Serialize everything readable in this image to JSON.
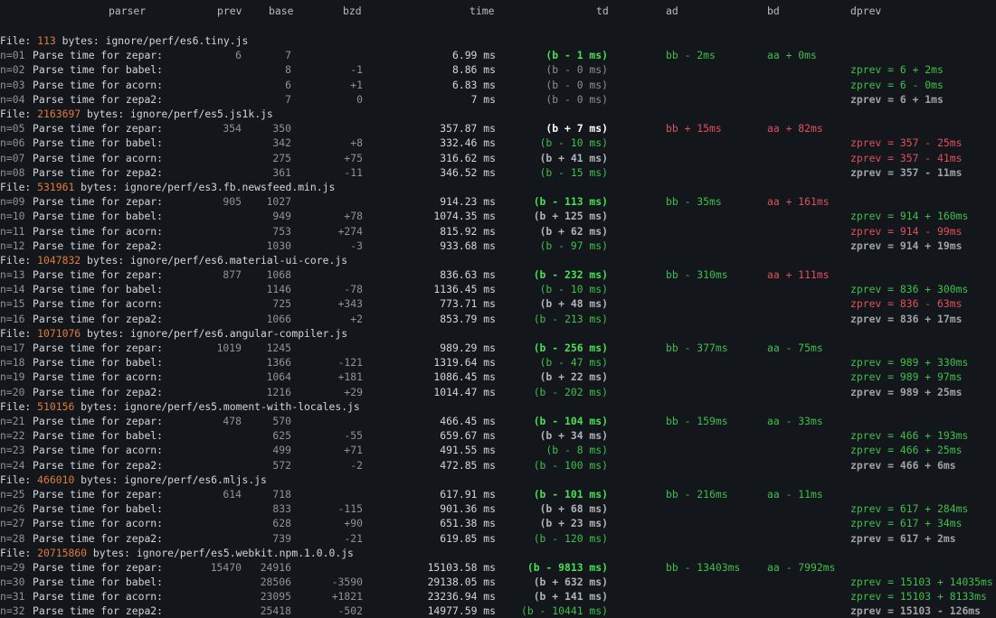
{
  "headers": {
    "parser": "parser",
    "prev": "prev",
    "base": "base",
    "bzd": "bzd",
    "time": "time",
    "td": "td",
    "ad": "ad",
    "bd": "bd",
    "dprev": "dprev"
  },
  "colors": {
    "background": "#13171c",
    "file_size": "#e07b3a",
    "green": "#3fbf4a",
    "red": "#e0505a",
    "white_bold": "#ffffff",
    "grey": "#8b9096"
  },
  "files": [
    {
      "prefix": "File: ",
      "size": "113",
      "path": " bytes: ignore/perf/es6.tiny.js",
      "rows": [
        {
          "n": "n=01",
          "label": "Parse time for zepar:",
          "prev": "6",
          "base": "7",
          "bzd": "",
          "time": "6.99 ms",
          "td": "(b - 1 ms)",
          "td_style": "bgreen",
          "ad": "bb - 2ms",
          "ad_style": "green",
          "bd": "aa + 0ms",
          "bd_style": "green",
          "dprev": "",
          "dprev_style": ""
        },
        {
          "n": "n=02",
          "label": "Parse time for babel:",
          "prev": "",
          "base": "8",
          "bzd": "-1",
          "time": "8.86 ms",
          "td": "(b - 0 ms)",
          "td_style": "grey",
          "ad": "",
          "ad_style": "",
          "bd": "",
          "bd_style": "",
          "dprev": "zprev = 6 + 2ms",
          "dprev_style": "pgreen"
        },
        {
          "n": "n=03",
          "label": "Parse time for acorn:",
          "prev": "",
          "base": "6",
          "bzd": "+1",
          "time": "6.83 ms",
          "td": "(b - 0 ms)",
          "td_style": "grey",
          "ad": "",
          "ad_style": "",
          "bd": "",
          "bd_style": "",
          "dprev": "zprev = 6 - 0ms",
          "dprev_style": "pgreen"
        },
        {
          "n": "n=04",
          "label": "Parse time for zepa2:",
          "prev": "",
          "base": "7",
          "bzd": "0",
          "time": "7 ms",
          "td": "(b - 0 ms)",
          "td_style": "grey",
          "ad": "",
          "ad_style": "",
          "bd": "",
          "bd_style": "",
          "dprev": "zprev = 6 + 1ms",
          "dprev_style": "pgrey"
        }
      ]
    },
    {
      "prefix": "File: ",
      "size": "2163697",
      "path": " bytes: ignore/perf/es5.js1k.js",
      "rows": [
        {
          "n": "n=05",
          "label": "Parse time for zepar:",
          "prev": "354",
          "base": "350",
          "bzd": "",
          "time": "357.87 ms",
          "td": "(b + 7 ms)",
          "td_style": "white",
          "ad": "bb + 15ms",
          "ad_style": "red",
          "bd": "aa + 82ms",
          "bd_style": "red",
          "dprev": "",
          "dprev_style": ""
        },
        {
          "n": "n=06",
          "label": "Parse time for babel:",
          "prev": "",
          "base": "342",
          "bzd": "+8",
          "time": "332.46 ms",
          "td": "(b - 10 ms)",
          "td_style": "green",
          "ad": "",
          "ad_style": "",
          "bd": "",
          "bd_style": "",
          "dprev": "zprev = 357 - 25ms",
          "dprev_style": "pred"
        },
        {
          "n": "n=07",
          "label": "Parse time for acorn:",
          "prev": "",
          "base": "275",
          "bzd": "+75",
          "time": "316.62 ms",
          "td": "(b + 41 ms)",
          "td_style": "bgrey",
          "ad": "",
          "ad_style": "",
          "bd": "",
          "bd_style": "",
          "dprev": "zprev = 357 - 41ms",
          "dprev_style": "pred"
        },
        {
          "n": "n=08",
          "label": "Parse time for zepa2:",
          "prev": "",
          "base": "361",
          "bzd": "-11",
          "time": "346.52 ms",
          "td": "(b - 15 ms)",
          "td_style": "green",
          "ad": "",
          "ad_style": "",
          "bd": "",
          "bd_style": "",
          "dprev": "zprev = 357 - 11ms",
          "dprev_style": "pgrey"
        }
      ]
    },
    {
      "prefix": "File: ",
      "size": "531961",
      "path": " bytes: ignore/perf/es3.fb.newsfeed.min.js",
      "rows": [
        {
          "n": "n=09",
          "label": "Parse time for zepar:",
          "prev": "905",
          "base": "1027",
          "bzd": "",
          "time": "914.23 ms",
          "td": "(b - 113 ms)",
          "td_style": "bgreen",
          "ad": "bb - 35ms",
          "ad_style": "green",
          "bd": "aa + 161ms",
          "bd_style": "red",
          "dprev": "",
          "dprev_style": ""
        },
        {
          "n": "n=10",
          "label": "Parse time for babel:",
          "prev": "",
          "base": "949",
          "bzd": "+78",
          "time": "1074.35 ms",
          "td": "(b + 125 ms)",
          "td_style": "bgrey",
          "ad": "",
          "ad_style": "",
          "bd": "",
          "bd_style": "",
          "dprev": "zprev = 914 + 160ms",
          "dprev_style": "pgreen"
        },
        {
          "n": "n=11",
          "label": "Parse time for acorn:",
          "prev": "",
          "base": "753",
          "bzd": "+274",
          "time": "815.92 ms",
          "td": "(b + 62 ms)",
          "td_style": "bgrey",
          "ad": "",
          "ad_style": "",
          "bd": "",
          "bd_style": "",
          "dprev": "zprev = 914 - 99ms",
          "dprev_style": "pred"
        },
        {
          "n": "n=12",
          "label": "Parse time for zepa2:",
          "prev": "",
          "base": "1030",
          "bzd": "-3",
          "time": "933.68 ms",
          "td": "(b - 97 ms)",
          "td_style": "green",
          "ad": "",
          "ad_style": "",
          "bd": "",
          "bd_style": "",
          "dprev": "zprev = 914 + 19ms",
          "dprev_style": "pgrey"
        }
      ]
    },
    {
      "prefix": "File: ",
      "size": "1047832",
      "path": " bytes: ignore/perf/es6.material-ui-core.js",
      "rows": [
        {
          "n": "n=13",
          "label": "Parse time for zepar:",
          "prev": "877",
          "base": "1068",
          "bzd": "",
          "time": "836.63 ms",
          "td": "(b - 232 ms)",
          "td_style": "bgreen",
          "ad": "bb - 310ms",
          "ad_style": "green",
          "bd": "aa + 111ms",
          "bd_style": "red",
          "dprev": "",
          "dprev_style": ""
        },
        {
          "n": "n=14",
          "label": "Parse time for babel:",
          "prev": "",
          "base": "1146",
          "bzd": "-78",
          "time": "1136.45 ms",
          "td": "(b - 10 ms)",
          "td_style": "green",
          "ad": "",
          "ad_style": "",
          "bd": "",
          "bd_style": "",
          "dprev": "zprev = 836 + 300ms",
          "dprev_style": "pgreen"
        },
        {
          "n": "n=15",
          "label": "Parse time for acorn:",
          "prev": "",
          "base": "725",
          "bzd": "+343",
          "time": "773.71 ms",
          "td": "(b + 48 ms)",
          "td_style": "bgrey",
          "ad": "",
          "ad_style": "",
          "bd": "",
          "bd_style": "",
          "dprev": "zprev = 836 - 63ms",
          "dprev_style": "pred"
        },
        {
          "n": "n=16",
          "label": "Parse time for zepa2:",
          "prev": "",
          "base": "1066",
          "bzd": "+2",
          "time": "853.79 ms",
          "td": "(b - 213 ms)",
          "td_style": "green",
          "ad": "",
          "ad_style": "",
          "bd": "",
          "bd_style": "",
          "dprev": "zprev = 836 + 17ms",
          "dprev_style": "pgrey"
        }
      ]
    },
    {
      "prefix": "File: ",
      "size": "1071076",
      "path": " bytes: ignore/perf/es6.angular-compiler.js",
      "rows": [
        {
          "n": "n=17",
          "label": "Parse time for zepar:",
          "prev": "1019",
          "base": "1245",
          "bzd": "",
          "time": "989.29 ms",
          "td": "(b - 256 ms)",
          "td_style": "bgreen",
          "ad": "bb - 377ms",
          "ad_style": "green",
          "bd": "aa - 75ms",
          "bd_style": "green",
          "dprev": "",
          "dprev_style": ""
        },
        {
          "n": "n=18",
          "label": "Parse time for babel:",
          "prev": "",
          "base": "1366",
          "bzd": "-121",
          "time": "1319.64 ms",
          "td": "(b - 47 ms)",
          "td_style": "green",
          "ad": "",
          "ad_style": "",
          "bd": "",
          "bd_style": "",
          "dprev": "zprev = 989 + 330ms",
          "dprev_style": "pgreen"
        },
        {
          "n": "n=19",
          "label": "Parse time for acorn:",
          "prev": "",
          "base": "1064",
          "bzd": "+181",
          "time": "1086.45 ms",
          "td": "(b + 22 ms)",
          "td_style": "bgrey",
          "ad": "",
          "ad_style": "",
          "bd": "",
          "bd_style": "",
          "dprev": "zprev = 989 + 97ms",
          "dprev_style": "pgreen"
        },
        {
          "n": "n=20",
          "label": "Parse time for zepa2:",
          "prev": "",
          "base": "1216",
          "bzd": "+29",
          "time": "1014.47 ms",
          "td": "(b - 202 ms)",
          "td_style": "green",
          "ad": "",
          "ad_style": "",
          "bd": "",
          "bd_style": "",
          "dprev": "zprev = 989 + 25ms",
          "dprev_style": "pgrey"
        }
      ]
    },
    {
      "prefix": "File: ",
      "size": "510156",
      "path": " bytes: ignore/perf/es5.moment-with-locales.js",
      "rows": [
        {
          "n": "n=21",
          "label": "Parse time for zepar:",
          "prev": "478",
          "base": "570",
          "bzd": "",
          "time": "466.45 ms",
          "td": "(b - 104 ms)",
          "td_style": "bgreen",
          "ad": "bb - 159ms",
          "ad_style": "green",
          "bd": "aa - 33ms",
          "bd_style": "green",
          "dprev": "",
          "dprev_style": ""
        },
        {
          "n": "n=22",
          "label": "Parse time for babel:",
          "prev": "",
          "base": "625",
          "bzd": "-55",
          "time": "659.67 ms",
          "td": "(b + 34 ms)",
          "td_style": "bgrey",
          "ad": "",
          "ad_style": "",
          "bd": "",
          "bd_style": "",
          "dprev": "zprev = 466 + 193ms",
          "dprev_style": "pgreen"
        },
        {
          "n": "n=23",
          "label": "Parse time for acorn:",
          "prev": "",
          "base": "499",
          "bzd": "+71",
          "time": "491.55 ms",
          "td": "(b - 8 ms)",
          "td_style": "green",
          "ad": "",
          "ad_style": "",
          "bd": "",
          "bd_style": "",
          "dprev": "zprev = 466 + 25ms",
          "dprev_style": "pgreen"
        },
        {
          "n": "n=24",
          "label": "Parse time for zepa2:",
          "prev": "",
          "base": "572",
          "bzd": "-2",
          "time": "472.85 ms",
          "td": "(b - 100 ms)",
          "td_style": "green",
          "ad": "",
          "ad_style": "",
          "bd": "",
          "bd_style": "",
          "dprev": "zprev = 466 + 6ms",
          "dprev_style": "pgrey"
        }
      ]
    },
    {
      "prefix": "File: ",
      "size": "466010",
      "path": " bytes: ignore/perf/es6.mljs.js",
      "rows": [
        {
          "n": "n=25",
          "label": "Parse time for zepar:",
          "prev": "614",
          "base": "718",
          "bzd": "",
          "time": "617.91 ms",
          "td": "(b - 101 ms)",
          "td_style": "bgreen",
          "ad": "bb - 216ms",
          "ad_style": "green",
          "bd": "aa - 11ms",
          "bd_style": "green",
          "dprev": "",
          "dprev_style": ""
        },
        {
          "n": "n=26",
          "label": "Parse time for babel:",
          "prev": "",
          "base": "833",
          "bzd": "-115",
          "time": "901.36 ms",
          "td": "(b + 68 ms)",
          "td_style": "bgrey",
          "ad": "",
          "ad_style": "",
          "bd": "",
          "bd_style": "",
          "dprev": "zprev = 617 + 284ms",
          "dprev_style": "pgreen"
        },
        {
          "n": "n=27",
          "label": "Parse time for acorn:",
          "prev": "",
          "base": "628",
          "bzd": "+90",
          "time": "651.38 ms",
          "td": "(b + 23 ms)",
          "td_style": "bgrey",
          "ad": "",
          "ad_style": "",
          "bd": "",
          "bd_style": "",
          "dprev": "zprev = 617 + 34ms",
          "dprev_style": "pgreen"
        },
        {
          "n": "n=28",
          "label": "Parse time for zepa2:",
          "prev": "",
          "base": "739",
          "bzd": "-21",
          "time": "619.85 ms",
          "td": "(b - 120 ms)",
          "td_style": "green",
          "ad": "",
          "ad_style": "",
          "bd": "",
          "bd_style": "",
          "dprev": "zprev = 617 + 2ms",
          "dprev_style": "pgrey"
        }
      ]
    },
    {
      "prefix": "File: ",
      "size": "20715860",
      "path": " bytes: ignore/perf/es5.webkit.npm.1.0.0.js",
      "rows": [
        {
          "n": "n=29",
          "label": "Parse time for zepar:",
          "prev": "15470",
          "base": "24916",
          "bzd": "",
          "time": "15103.58 ms",
          "td": "(b - 9813 ms)",
          "td_style": "bgreen",
          "ad": "bb - 13403ms",
          "ad_style": "green",
          "bd": "aa - 7992ms",
          "bd_style": "green",
          "dprev": "",
          "dprev_style": ""
        },
        {
          "n": "n=30",
          "label": "Parse time for babel:",
          "prev": "",
          "base": "28506",
          "bzd": "-3590",
          "time": "29138.05 ms",
          "td": "(b + 632 ms)",
          "td_style": "bgrey",
          "ad": "",
          "ad_style": "",
          "bd": "",
          "bd_style": "",
          "dprev": "zprev = 15103 + 14035ms",
          "dprev_style": "pgreen"
        },
        {
          "n": "n=31",
          "label": "Parse time for acorn:",
          "prev": "",
          "base": "23095",
          "bzd": "+1821",
          "time": "23236.94 ms",
          "td": "(b + 141 ms)",
          "td_style": "bgrey",
          "ad": "",
          "ad_style": "",
          "bd": "",
          "bd_style": "",
          "dprev": "zprev = 15103 + 8133ms",
          "dprev_style": "pgreen"
        },
        {
          "n": "n=32",
          "label": "Parse time for zepa2:",
          "prev": "",
          "base": "25418",
          "bzd": "-502",
          "time": "14977.59 ms",
          "td": "(b - 10441 ms)",
          "td_style": "green",
          "ad": "",
          "ad_style": "",
          "bd": "",
          "bd_style": "",
          "dprev": "zprev = 15103 - 126ms",
          "dprev_style": "pgrey"
        }
      ]
    }
  ]
}
